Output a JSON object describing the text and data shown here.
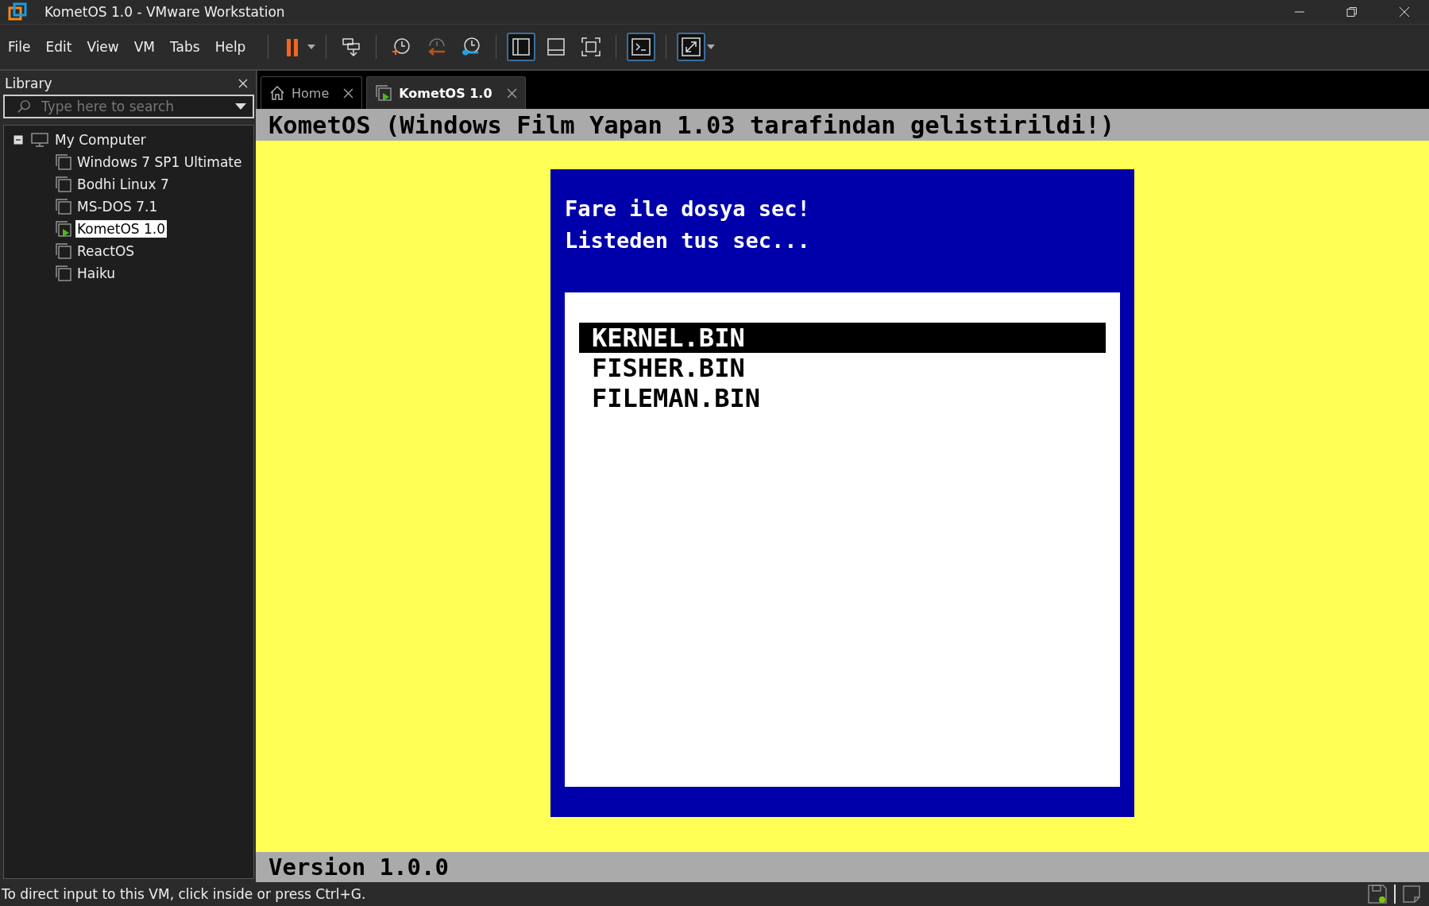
{
  "window": {
    "title": "KometOS 1.0 - VMware Workstation"
  },
  "menu": [
    "File",
    "Edit",
    "View",
    "VM",
    "Tabs",
    "Help"
  ],
  "toolbar": [
    {
      "items": [
        {
          "kind": "pause",
          "on": false
        },
        {
          "kind": "dropdown",
          "on": false
        }
      ]
    },
    {
      "items": [
        {
          "kind": "send-keys",
          "on": false
        }
      ]
    },
    {
      "items": [
        {
          "kind": "snapshot-take",
          "on": false
        },
        {
          "kind": "snapshot-revert",
          "on": false
        },
        {
          "kind": "snapshot-manager",
          "on": false
        }
      ]
    },
    {
      "items": [
        {
          "kind": "library-view",
          "on": true
        },
        {
          "kind": "thumbnail-view",
          "on": false
        },
        {
          "kind": "full-screen",
          "on": false
        }
      ]
    },
    {
      "items": [
        {
          "kind": "console",
          "on": true
        }
      ]
    },
    {
      "items": [
        {
          "kind": "stretch",
          "on": true
        },
        {
          "kind": "dropdown",
          "on": false
        }
      ]
    }
  ],
  "library": {
    "title": "Library",
    "search": {
      "placeholder": "Type here to search"
    },
    "tree": [
      {
        "label": "My Computer",
        "kind": "computer",
        "expanded": true,
        "selected": false,
        "children": [
          {
            "label": "Windows 7 SP1 Ultimate",
            "kind": "vm",
            "running": false,
            "selected": false
          },
          {
            "label": "Bodhi Linux 7",
            "kind": "vm",
            "running": false,
            "selected": false
          },
          {
            "label": "MS-DOS 7.1",
            "kind": "vm",
            "running": false,
            "selected": false
          },
          {
            "label": "KometOS 1.0",
            "kind": "vm",
            "running": true,
            "selected": true
          },
          {
            "label": "ReactOS",
            "kind": "vm",
            "running": false,
            "selected": false
          },
          {
            "label": "Haiku",
            "kind": "vm",
            "running": false,
            "selected": false
          }
        ]
      }
    ]
  },
  "tabs": [
    {
      "label": "Home",
      "kind": "home",
      "selected": false
    },
    {
      "label": "KometOS 1.0",
      "kind": "vm",
      "selected": true
    }
  ],
  "guest": {
    "header": "KometOS (Windows Film Yapan 1.03 tarafindan gelistirildi!)",
    "dialog": {
      "lines": [
        "Fare ile dosya sec!",
        "Listeden tus sec..."
      ],
      "files": [
        {
          "name": "KERNEL.BIN",
          "selected": true
        },
        {
          "name": "FISHER.BIN",
          "selected": false
        },
        {
          "name": "FILEMAN.BIN",
          "selected": false
        }
      ]
    },
    "footer": "Version 1.0.0"
  },
  "status_bar": {
    "text": "To direct input to this VM, click inside or press Ctrl+G."
  }
}
